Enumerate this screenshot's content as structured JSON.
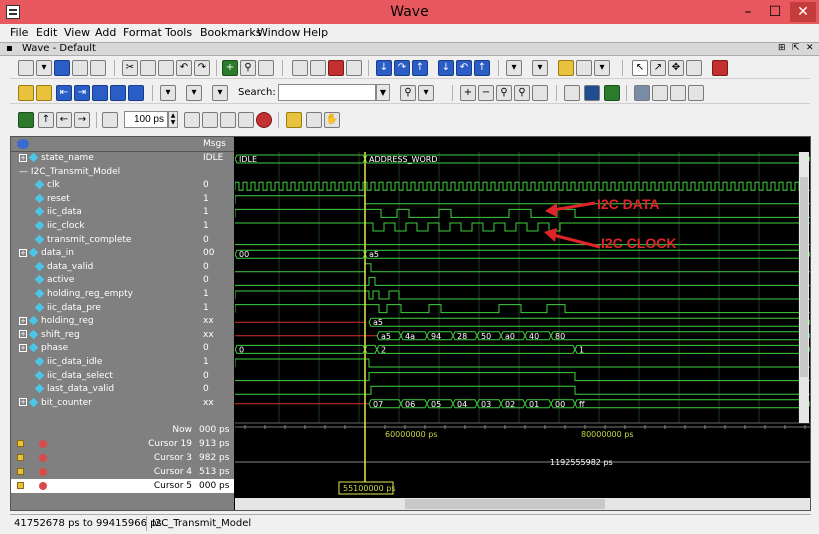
{
  "window": {
    "title": "Wave",
    "subtitle": "Wave - Default",
    "minimize": "–",
    "maximize": "☐",
    "close": "✕"
  },
  "menu": [
    "File",
    "Edit",
    "View",
    "Add",
    "Format",
    "Tools",
    "Bookmarks",
    "Window",
    "Help"
  ],
  "toolbar": {
    "search_label": "Search:",
    "search_value": "",
    "zoom_value": "100 ps"
  },
  "header": {
    "msgs": "Msgs"
  },
  "signals": [
    {
      "name": "state_name",
      "value": "IDLE",
      "expand": true
    },
    {
      "name": "I2C_Transmit_Model",
      "value": "",
      "group": true
    },
    {
      "name": "clk",
      "value": "0"
    },
    {
      "name": "reset",
      "value": "1"
    },
    {
      "name": "iic_data",
      "value": "1"
    },
    {
      "name": "iic_clock",
      "value": "1"
    },
    {
      "name": "transmit_complete",
      "value": "0"
    },
    {
      "name": "data_in",
      "value": "00",
      "expand": true
    },
    {
      "name": "data_valid",
      "value": "0"
    },
    {
      "name": "active",
      "value": "0"
    },
    {
      "name": "holding_reg_empty",
      "value": "1"
    },
    {
      "name": "iic_data_pre",
      "value": "1"
    },
    {
      "name": "holding_reg",
      "value": "xx",
      "expand": true
    },
    {
      "name": "shift_reg",
      "value": "xx",
      "expand": true
    },
    {
      "name": "phase",
      "value": "0",
      "expand": true
    },
    {
      "name": "iic_data_idle",
      "value": "1"
    },
    {
      "name": "iic_data_select",
      "value": "0"
    },
    {
      "name": "last_data_valid",
      "value": "0"
    },
    {
      "name": "bit_counter",
      "value": "xx",
      "expand": true
    }
  ],
  "cursors": [
    {
      "name": "Now",
      "value": "000 ps"
    },
    {
      "name": "Cursor 19",
      "value": "913 ps"
    },
    {
      "name": "Cursor 3",
      "value": "982 ps"
    },
    {
      "name": "Cursor 4",
      "value": "513 ps"
    },
    {
      "name": "Cursor 5",
      "value": "000 ps"
    }
  ],
  "wave_labels": {
    "state_idle": "IDLE",
    "state_addr": "ADDRESS_WORD",
    "data_in_00": "00",
    "data_in_a5": "a5",
    "holding_a5": "a5",
    "shift_vals": [
      "a5",
      "4a",
      "94",
      "28",
      "50",
      "a0",
      "40",
      "80"
    ],
    "phase_vals": [
      "0",
      "2",
      "1"
    ],
    "bit_vals": [
      "07",
      "06",
      "05",
      "04",
      "03",
      "02",
      "01",
      "00",
      "ff"
    ]
  },
  "timeline": {
    "t1": "60000000 ps",
    "t2": "80000000 ps",
    "cursor_delta": "1192555982 ps",
    "cursor_time": "55100000 ps"
  },
  "annotations": {
    "data": "I2C DATA",
    "clock": "I2C CLOCK"
  },
  "status": {
    "range": "41752678 ps to 99415966 ps",
    "scope": "I2C_Transmit_Model"
  },
  "colors": {
    "wave": "#3fd13f",
    "cursor": "#e8e84a",
    "annotation": "#e0252a",
    "titlebar": "#e8585f",
    "undefined": "#d43030"
  }
}
